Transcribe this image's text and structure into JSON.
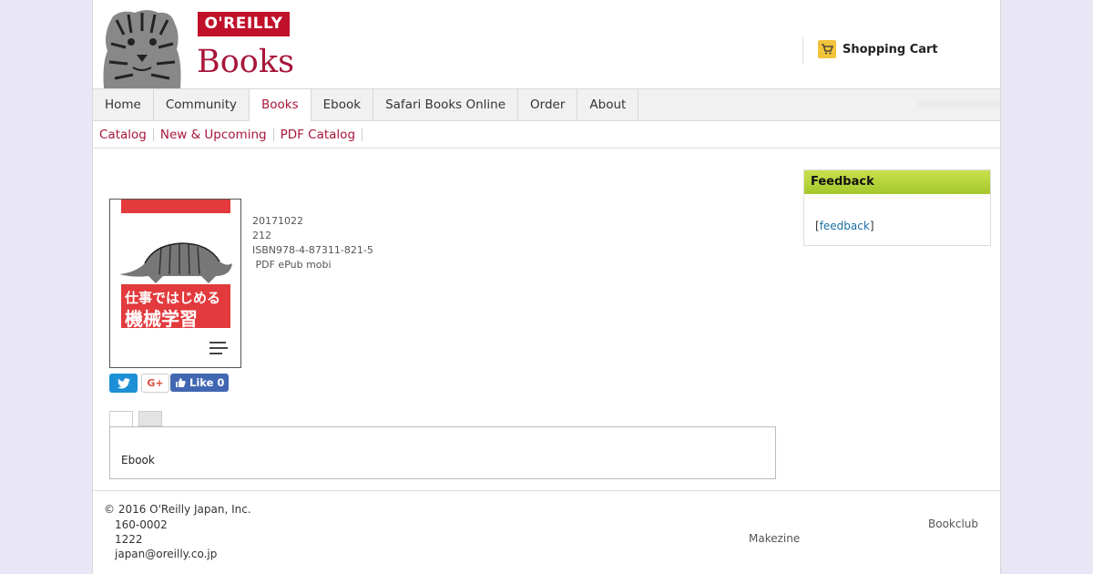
{
  "header": {
    "logo_text": "O'REILLY",
    "books_title": "Books",
    "cart_label": "Shopping Cart"
  },
  "nav": {
    "items": [
      {
        "label": "Home",
        "active": false
      },
      {
        "label": "Community",
        "active": false
      },
      {
        "label": "Books",
        "active": true
      },
      {
        "label": "Ebook",
        "active": false
      },
      {
        "label": "Safari Books Online",
        "active": false
      },
      {
        "label": "Order",
        "active": false
      },
      {
        "label": "About",
        "active": false
      }
    ]
  },
  "subnav": {
    "items": [
      "Catalog",
      "New & Upcoming",
      "PDF Catalog"
    ]
  },
  "book": {
    "cover_title_line1": "仕事ではじめる",
    "cover_title_line2": "機械学習",
    "date": "20171022",
    "pages": "212",
    "isbn": "ISBN978-4-87311-821-5",
    "formats": " PDF ePub mobi"
  },
  "share": {
    "gplus_label": "G+",
    "like_label": "Like 0"
  },
  "tabs": {
    "panel_text": "Ebook"
  },
  "feedback": {
    "heading": "Feedback",
    "bracket_open": "[",
    "link": "feedback",
    "bracket_close": "]"
  },
  "footer": {
    "copyright": "© 2016 O'Reilly Japan, Inc.",
    "postal": "160-0002",
    "line2": "1222",
    "email": "japan@oreilly.co.jp",
    "makezine": "Makezine",
    "bookclub": "Bookclub"
  },
  "colors": {
    "brand_red": "#c0102a",
    "link_red": "#a8163a",
    "feedback_green": "#b5d33a",
    "twitter_blue": "#1c8fd6",
    "facebook_blue": "#4267b2"
  }
}
